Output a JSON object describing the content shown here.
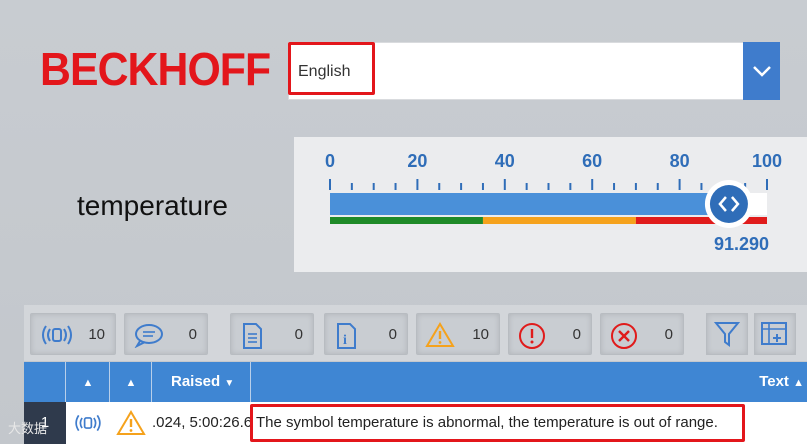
{
  "brand": {
    "logo_text": "BECKHOFF",
    "logo_color": "#e3161b"
  },
  "language": {
    "selected": "English",
    "dropdown_icon": "chevron-down-icon"
  },
  "temperature": {
    "label": "temperature",
    "scale_labels": [
      "0",
      "20",
      "40",
      "60",
      "80",
      "100"
    ],
    "min": 0,
    "max": 100,
    "value": 91.29,
    "value_display": "91.290",
    "range_colors": [
      "#1f8a28",
      "#f5a21c",
      "#e01b1b"
    ],
    "track_color": "#4a90d9"
  },
  "alarm_filters": [
    {
      "icon": "alarm-broadcast-icon",
      "count": "10"
    },
    {
      "icon": "message-bubble-icon",
      "count": "0"
    },
    {
      "icon": "document-icon",
      "count": "0"
    },
    {
      "icon": "info-icon",
      "count": "0"
    },
    {
      "icon": "warning-icon",
      "count": "10"
    },
    {
      "icon": "error-icon",
      "count": "0"
    },
    {
      "icon": "critical-error-icon",
      "count": "0"
    }
  ],
  "toolbar_icons": {
    "filter": "filter-icon",
    "columns": "table-columns-icon"
  },
  "table": {
    "columns": {
      "raised": "Raised",
      "text": "Text"
    },
    "row": {
      "number": "1",
      "raised": ".024, 5:00:26.6",
      "text": "The symbol temperature is abnormal, the temperature is out of  range."
    }
  },
  "watermark": "大数据"
}
